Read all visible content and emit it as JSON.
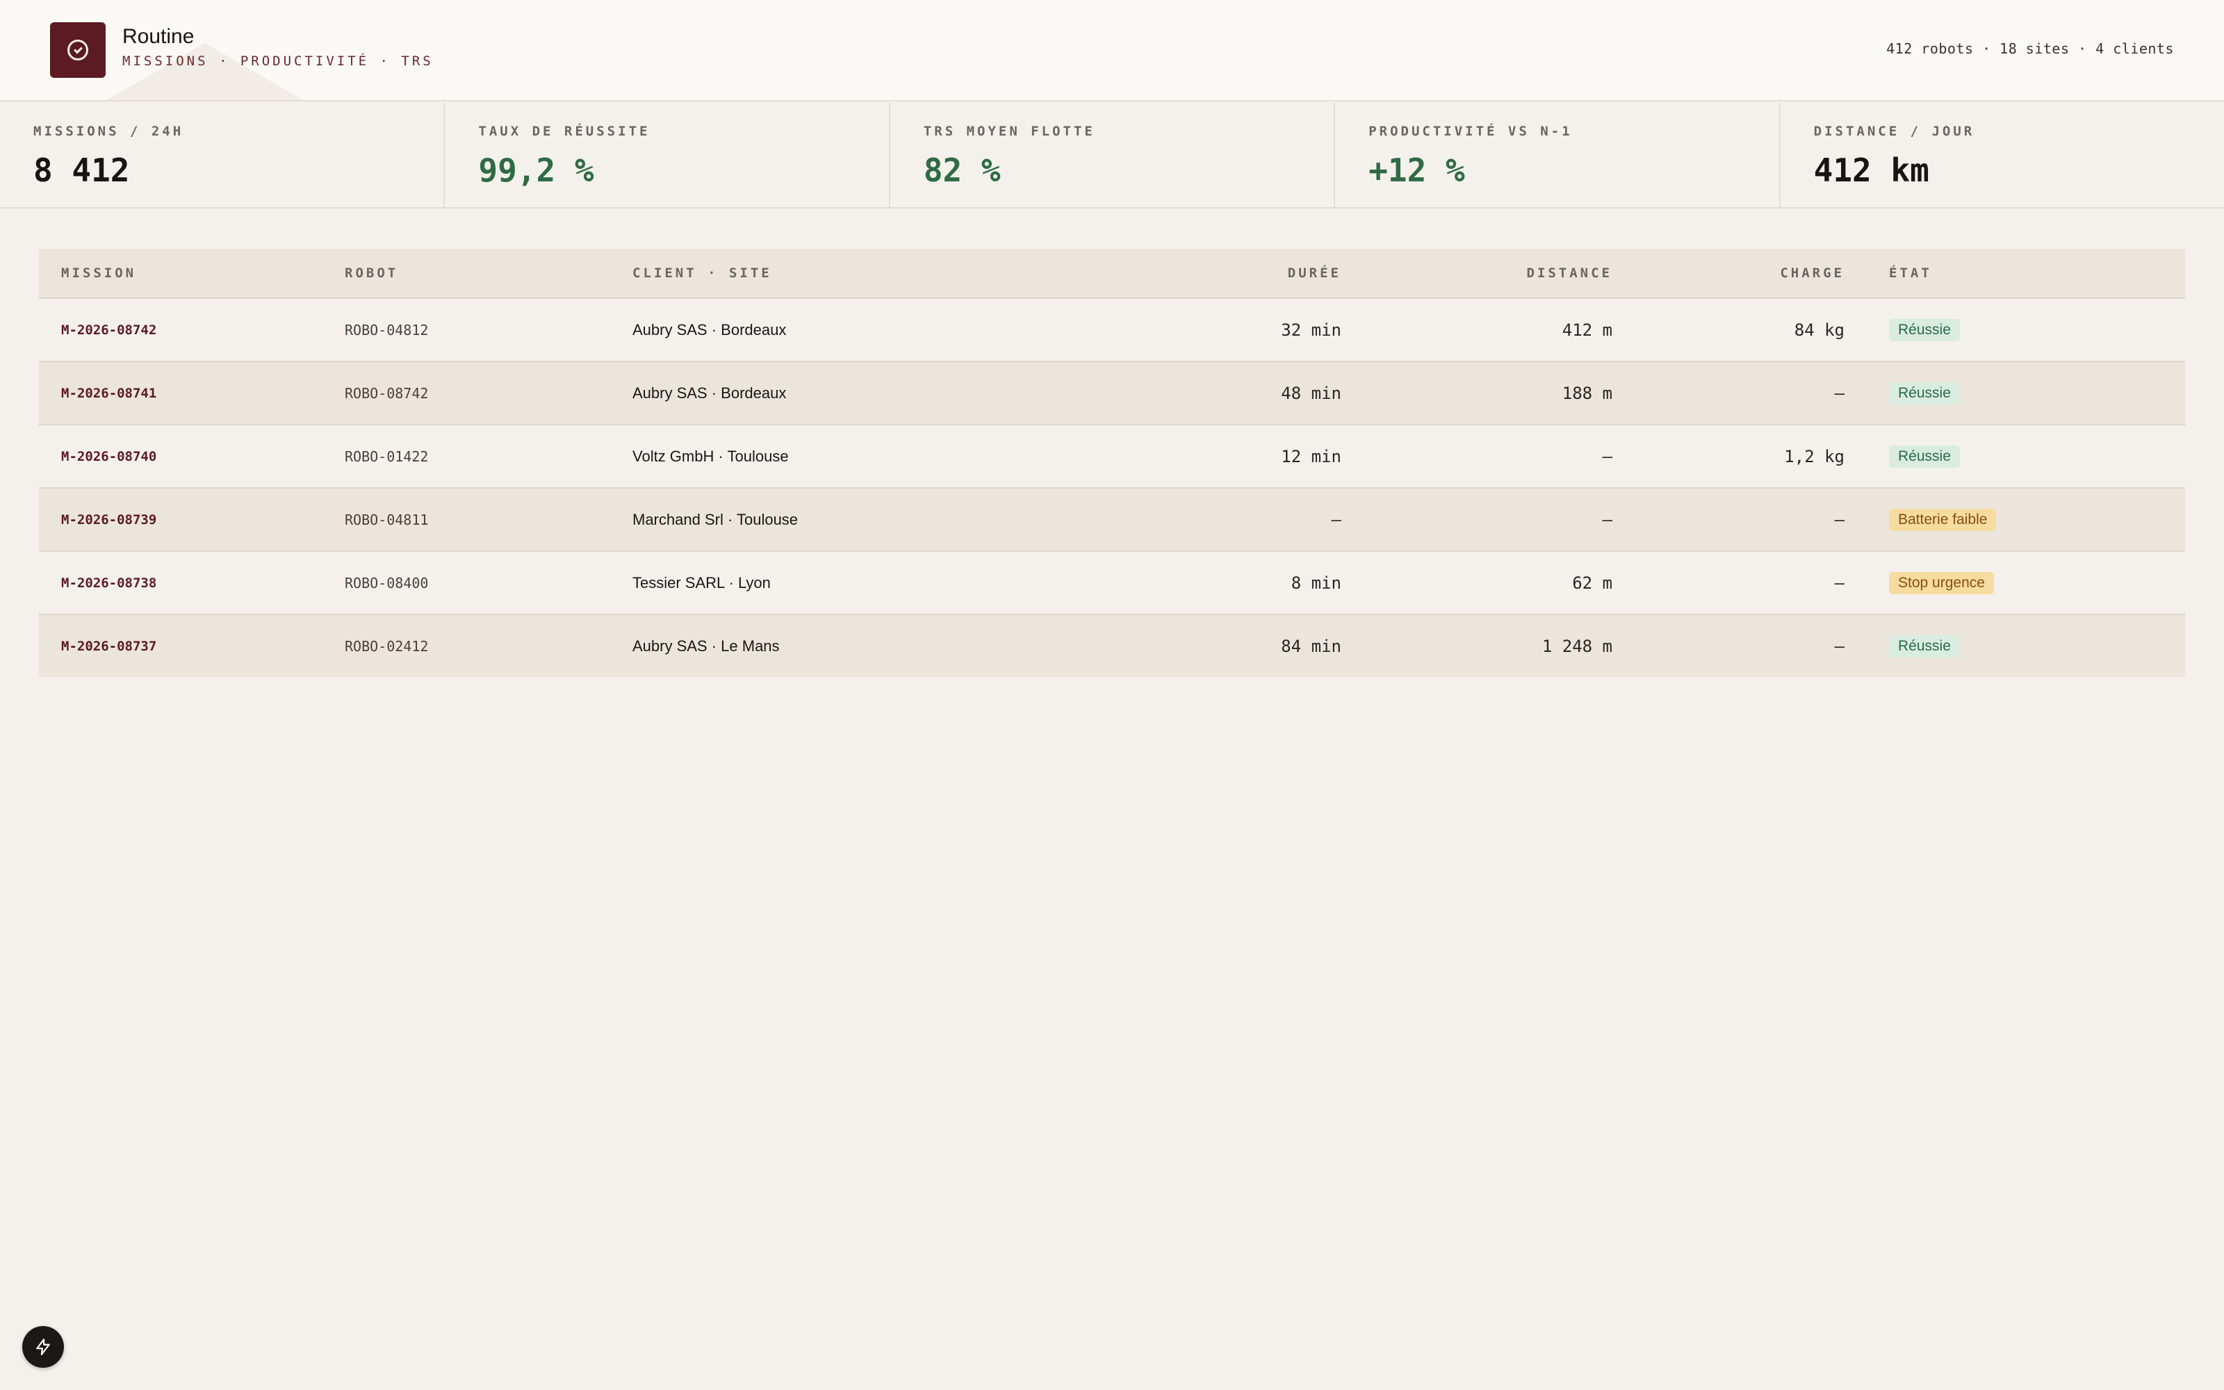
{
  "header": {
    "title": "Routine",
    "subtitle": "MISSIONS · PRODUCTIVITÉ · TRS",
    "fleet_summary": "412 robots · 18 sites · 4 clients",
    "logo_icon": "check-circle-icon"
  },
  "kpis": [
    {
      "label": "MISSIONS / 24H",
      "value": "8 412",
      "color": "#1a1414"
    },
    {
      "label": "TAUX DE RÉUSSITE",
      "value": "99,2 %",
      "color": "#2f6b45"
    },
    {
      "label": "TRS MOYEN FLOTTE",
      "value": "82 %",
      "color": "#2f6b45"
    },
    {
      "label": "PRODUCTIVITÉ VS N-1",
      "value": "+12 %",
      "color": "#2f6b45"
    },
    {
      "label": "DISTANCE / JOUR",
      "value": "412 km",
      "color": "#1a1414"
    }
  ],
  "table": {
    "columns": [
      "MISSION",
      "ROBOT",
      "CLIENT · SITE",
      "DURÉE",
      "DISTANCE",
      "CHARGE",
      "ÉTAT"
    ],
    "rows": [
      {
        "mission": "M-2026-08742",
        "robot": "ROBO-04812",
        "client": "Aubry SAS · Bordeaux",
        "duration": "32 min",
        "distance": "412 m",
        "charge": "84 kg",
        "state": "Réussie",
        "state_kind": "ok"
      },
      {
        "mission": "M-2026-08741",
        "robot": "ROBO-08742",
        "client": "Aubry SAS · Bordeaux",
        "duration": "48 min",
        "distance": "188 m",
        "charge": "—",
        "state": "Réussie",
        "state_kind": "ok"
      },
      {
        "mission": "M-2026-08740",
        "robot": "ROBO-01422",
        "client": "Voltz GmbH · Toulouse",
        "duration": "12 min",
        "distance": "—",
        "charge": "1,2 kg",
        "state": "Réussie",
        "state_kind": "ok"
      },
      {
        "mission": "M-2026-08739",
        "robot": "ROBO-04811",
        "client": "Marchand Srl · Toulouse",
        "duration": "—",
        "distance": "—",
        "charge": "—",
        "state": "Batterie faible",
        "state_kind": "warn"
      },
      {
        "mission": "M-2026-08738",
        "robot": "ROBO-08400",
        "client": "Tessier SARL · Lyon",
        "duration": "8 min",
        "distance": "62 m",
        "charge": "—",
        "state": "Stop urgence",
        "state_kind": "warn"
      },
      {
        "mission": "M-2026-08737",
        "robot": "ROBO-02412",
        "client": "Aubry SAS · Le Mans",
        "duration": "84 min",
        "distance": "1 248 m",
        "charge": "—",
        "state": "Réussie",
        "state_kind": "ok"
      }
    ]
  },
  "floating_button": {
    "icon": "bolt-icon"
  },
  "colors": {
    "brand": "#5c1a23",
    "success_bg": "#d9ecdf",
    "success_fg": "#2a6a46",
    "warning_bg": "#f6dca0",
    "warning_fg": "#8a4c12"
  }
}
